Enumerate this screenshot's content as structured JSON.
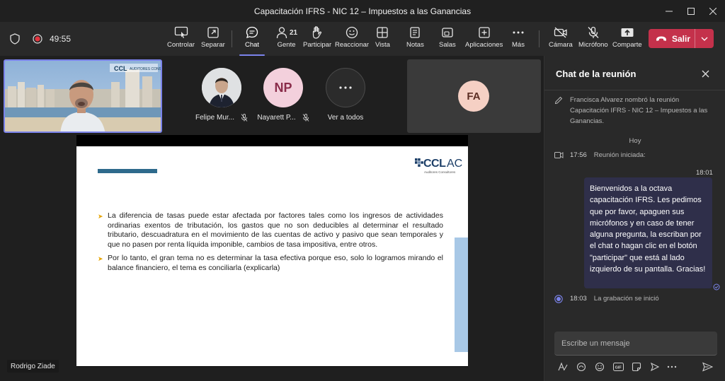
{
  "window": {
    "title": "Capacitación IFRS - NIC 12 – Impuestos a las Ganancias"
  },
  "toolbar": {
    "timer": "49:55",
    "buttons": {
      "controlar": "Controlar",
      "separar": "Separar",
      "chat": "Chat",
      "gente": "Gente",
      "gente_count": "21",
      "participar": "Participar",
      "reaccionar": "Reaccionar",
      "vista": "Vista",
      "notas": "Notas",
      "salas": "Salas",
      "aplicaciones": "Aplicaciones",
      "mas": "Más",
      "camara": "Cámara",
      "microfono": "Micrófono",
      "comparte": "Comparte"
    },
    "leave_label": "Salir"
  },
  "participants": [
    {
      "name": "Felipe Mur...",
      "initials": ""
    },
    {
      "name": "Nayarett P...",
      "initials": "NP"
    },
    {
      "name": "Ver a todos",
      "initials": ""
    }
  ],
  "fa_tile": {
    "initials": "FA"
  },
  "presenter": {
    "name": "Rodrigo Ziade"
  },
  "slide": {
    "logo_main": "CCL",
    "logo_suffix": "AC",
    "logo_sub": "Auditores Consultores",
    "bullets": [
      "La diferencia de tasas puede estar afectada por factores tales como los ingresos de actividades ordinarias exentos de tributación, los gastos que no son deducibles al determinar el resultado tributario, descuadratura en el movimiento de las cuentas de activo y pasivo que sean temporales y que no pasen por renta líquida imponible, cambios de tasa impositiva, entre otros.",
      "Por lo tanto, el gran tema no es determinar la tasa efectiva porque eso, solo lo logramos mirando el balance financiero, el tema es conciliarla (explicarla)"
    ]
  },
  "chat": {
    "title": "Chat de la reunión",
    "rename_event": "Francisca Alvarez nombró la reunión Capacitación IFRS - NIC 12 – Impuestos a las Ganancias.",
    "day_label": "Hoy",
    "meeting_started_time": "17:56",
    "meeting_started_text": "Reunión iniciada:",
    "message_time": "18:01",
    "message_text": "Bienvenidos a la octava capacitación IFRS. Les pedimos que por favor, apaguen sus micrófonos y en caso de tener alguna pregunta, la escriban por el chat o hagan clic en el botón \"participar\" que está al lado izquierdo de su pantalla. Gracias!",
    "recording_time": "18:03",
    "recording_text": "La grabación se inició",
    "composer_placeholder": "Escribe un mensaje"
  },
  "colors": {
    "accent": "#7b83eb",
    "leave": "#c4314b",
    "bubble": "#2f2f4a",
    "slide_bar": "#2e6a8c",
    "slide_side": "#a8c8e6"
  }
}
